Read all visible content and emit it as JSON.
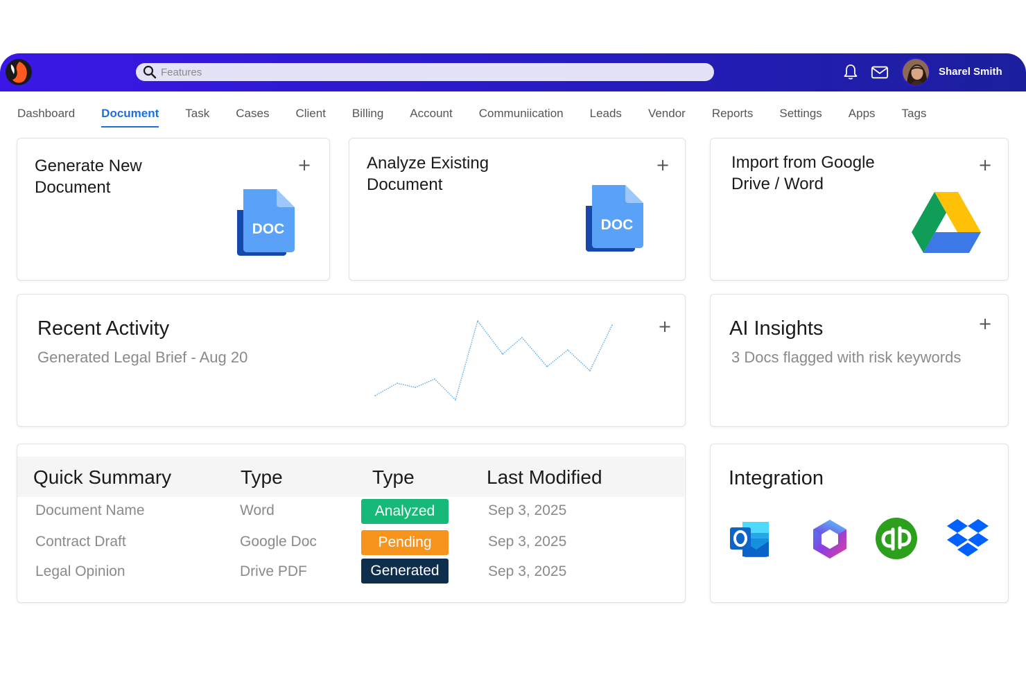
{
  "header": {
    "search_placeholder": "Features",
    "user_name": "Sharel Smith"
  },
  "nav": {
    "items": [
      "Dashboard",
      "Document",
      "Task",
      "Cases",
      "Client",
      "Billing",
      "Account",
      "Communiication",
      "Leads",
      "Vendor",
      "Reports",
      "Settings",
      "Apps",
      "Tags"
    ],
    "active": "Document"
  },
  "cards": {
    "generate": {
      "title_line1": "Generate New",
      "title_line2": "Document",
      "icon_label": "DOC",
      "plus": "+"
    },
    "analyze": {
      "title_line1": "Analyze Existing",
      "title_line2": "Document",
      "icon_label": "DOC",
      "plus": "+"
    },
    "import": {
      "title_line1": "Import from Google",
      "title_line2": "Drive / Word",
      "plus": "+"
    },
    "recent": {
      "title": "Recent Activity",
      "subtitle": "Generated Legal Brief - Aug 20",
      "plus": "+"
    },
    "insights": {
      "title": "AI Insights",
      "subtitle": "3 Docs flagged with risk keywords",
      "plus": "+"
    },
    "integration": {
      "title": "Integration",
      "icons": [
        "outlook-icon",
        "copilot-icon",
        "quickbooks-icon",
        "dropbox-icon"
      ]
    }
  },
  "summary": {
    "headers": [
      "Quick Summary",
      "Type",
      "Type",
      "Last Modified"
    ],
    "rows": [
      {
        "name": "Document Name",
        "type": "Word",
        "status": "Analyzed",
        "modified": "Sep 3, 2025"
      },
      {
        "name": "Contract Draft",
        "type": "Google Doc",
        "status": "Pending",
        "modified": "Sep 3, 2025"
      },
      {
        "name": "Legal Opinion",
        "type": "Drive PDF",
        "status": "Generated",
        "modified": "Sep 3, 2025"
      }
    ]
  },
  "colors": {
    "accent": "#1d6fe0",
    "topbar": "#2a1ac9",
    "analyzed": "#17b978",
    "pending": "#f7941d",
    "generated": "#0f2e4c",
    "sparkline": "#5aa9e6"
  },
  "chart_data": {
    "type": "line",
    "series": [
      {
        "values": [
          2,
          5,
          4,
          6,
          1,
          20,
          12,
          16,
          9,
          13,
          8,
          19
        ]
      }
    ]
  }
}
